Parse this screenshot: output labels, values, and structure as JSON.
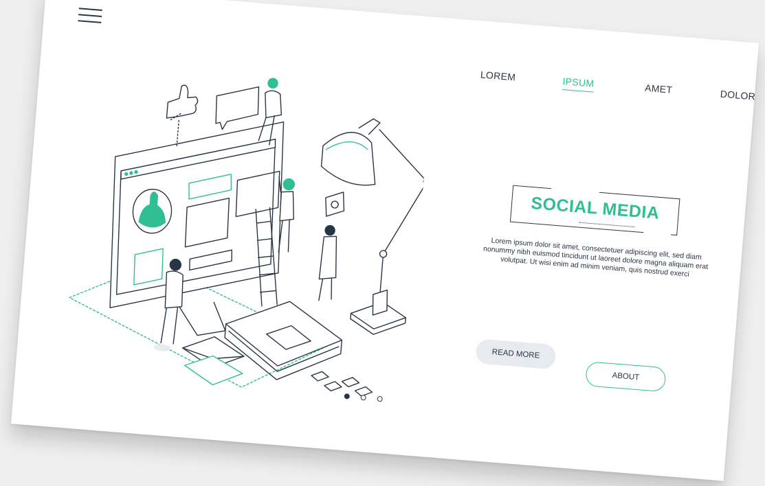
{
  "nav": {
    "items": [
      {
        "label": "LOREM",
        "active": false
      },
      {
        "label": "IPSUM",
        "active": true
      },
      {
        "label": "AMET",
        "active": false
      },
      {
        "label": "DOLOR",
        "active": false
      }
    ]
  },
  "hero": {
    "title": "SOCIAL MEDIA",
    "body": "Lorem ipsum dolor sit amet, consectetuer adipiscing elit, sed diam nonummy nibh euismod tincidunt ut laoreet dolore magna aliquam erat volutpat. Ut wisi enim ad minim veniam, quis nostrud exerci"
  },
  "buttons": {
    "read_more": "READ MORE",
    "about": "ABOUT"
  },
  "pagination": {
    "count": 3,
    "active_index": 0
  },
  "icons": [
    "menu-icon",
    "thumbs-up-icon",
    "chat-bubble-icon",
    "envelope-icon",
    "desk-lamp-icon"
  ],
  "colors": {
    "accent": "#2fbf93",
    "text": "#2b3444",
    "button_bg": "#e7ebf0",
    "background": "#efefef"
  }
}
